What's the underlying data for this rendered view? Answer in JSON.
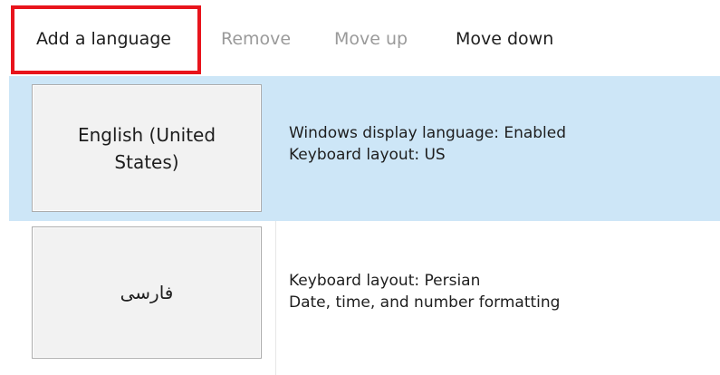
{
  "toolbar": {
    "add_label": "Add a language",
    "remove_label": "Remove",
    "move_up_label": "Move up",
    "move_down_label": "Move down",
    "highlight_color": "#e8141c"
  },
  "languages": [
    {
      "name": "English (United States)",
      "details": [
        "Windows display language: Enabled",
        "Keyboard layout: US"
      ],
      "selected": true
    },
    {
      "name": "فارسی",
      "details": [
        "Keyboard layout: Persian",
        "Date, time, and number formatting"
      ],
      "selected": false
    }
  ],
  "colors": {
    "selected_row": "#cde6f7",
    "disabled_text": "#9a9a9a",
    "tile_background": "#f2f2f2",
    "tile_border": "#acacac"
  }
}
